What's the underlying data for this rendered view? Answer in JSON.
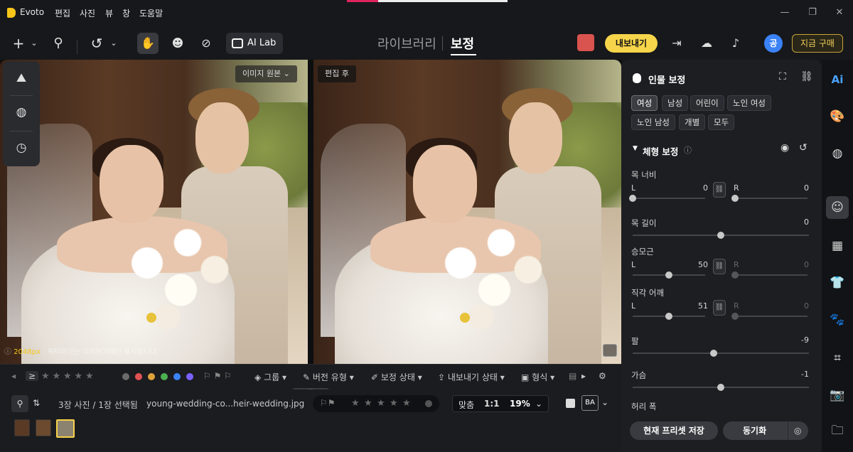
{
  "titlebar": {
    "app_name": "Evoto",
    "menus": [
      "편집",
      "사진",
      "뷰",
      "창",
      "도움말"
    ],
    "controls": {
      "minimize": "—",
      "restore": "❐",
      "close": "✕"
    }
  },
  "toolbar": {
    "add_icon": "+",
    "search_icon": "⚲",
    "undo_icon": "↺",
    "hand_icon": "✋",
    "ai_lab_label": "AI Lab",
    "nav_library": "라이브러리",
    "nav_edit": "보정",
    "export_label": "내보내기",
    "avatar_letter": "공",
    "buy_label": "지금 구매"
  },
  "viewer": {
    "original_label": "이미지 원본",
    "after_label": "편집 후",
    "watermark_size": "2048px",
    "watermark_text": "- 워터마크는 미리보기에만 표시됩니다."
  },
  "filterbar": {
    "ge_symbol": "≥",
    "stars": [
      "★",
      "★",
      "★",
      "★",
      "★"
    ],
    "color_dots": [
      "#6a6a6a",
      "#e05252",
      "#e0a13a",
      "#4caf50",
      "#3b82f6",
      "#7b61ff"
    ],
    "group_label": "그룹",
    "version_label": "버전 유형",
    "status_label": "보정 상태",
    "export_status_label": "내보내기 상태",
    "format_label": "형식"
  },
  "filmbar": {
    "count_text": "3장 사진 / 1장 선택됨",
    "filename": "young-wedding-co...heir-wedding.jpg",
    "stars": [
      "★",
      "★",
      "★",
      "★",
      "★"
    ],
    "fit_label": "맞춤",
    "one_to_one": "1:1",
    "zoom_value": "19%",
    "ba_label": "BA"
  },
  "panel": {
    "title": "인물 보정",
    "chips": [
      "여성",
      "남성",
      "어린이",
      "노인 여성",
      "노인 남성",
      "개별",
      "모두"
    ],
    "section_title": "체형 보정",
    "sliders": [
      {
        "label": "목 너비",
        "left_tag": "L",
        "left_value": "0",
        "right_tag": "R",
        "right_value": "0",
        "left_fraction": 0.0,
        "right_fraction": 0.0,
        "dual": true,
        "right_active": true
      },
      {
        "label": "목 길이",
        "value": "0",
        "fraction": 0.5,
        "dual": false
      },
      {
        "label": "승모근",
        "left_tag": "L",
        "left_value": "50",
        "right_tag": "R",
        "right_value": "0",
        "left_fraction": 0.5,
        "right_fraction": 0.0,
        "dual": true,
        "right_active": false
      },
      {
        "label": "직각 어깨",
        "left_tag": "L",
        "left_value": "51",
        "right_tag": "R",
        "right_value": "0",
        "left_fraction": 0.5,
        "right_fraction": 0.0,
        "dual": true,
        "right_active": false
      },
      {
        "label": "팔",
        "value": "-9",
        "fraction": 0.46,
        "dual": false
      },
      {
        "label": "가슴",
        "value": "-1",
        "fraction": 0.5,
        "dual": false
      }
    ],
    "waist_label": "허리 폭",
    "preset_button": "현재 프리셋 저장",
    "sync_button": "동기화"
  },
  "sidebar_icons": [
    "ai-icon",
    "palette-icon",
    "texture-icon",
    "face-icon",
    "grid-icon",
    "shirt-icon",
    "paw-icon",
    "crop-icon",
    "camera-icon",
    "folder-icon"
  ],
  "accent_colors": {
    "export": "#f7d54a",
    "avatar": "#3b82f6",
    "buy": "#f2cf5a"
  }
}
